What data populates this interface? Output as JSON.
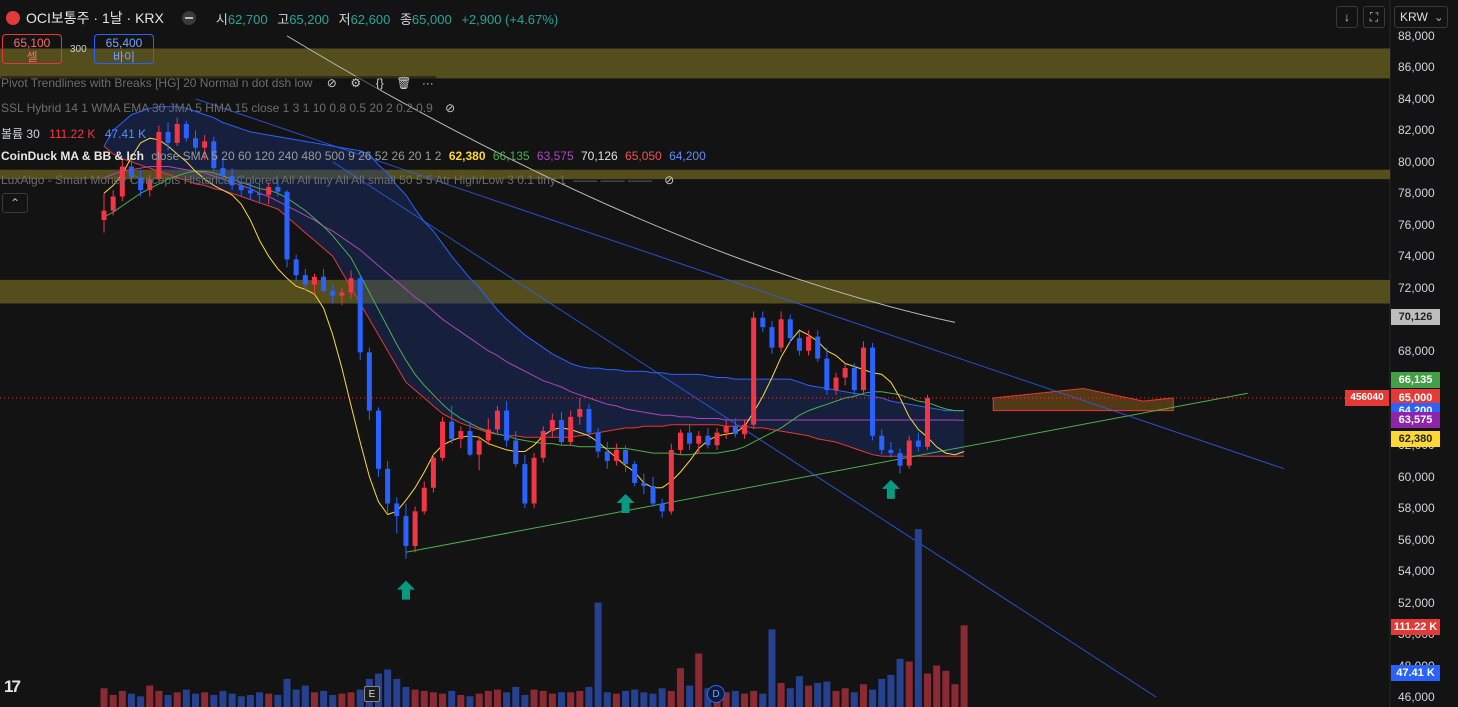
{
  "header": {
    "symbol": "OCI보통주 · 1날 · KRX",
    "open_label": "시",
    "open": "62,700",
    "high_label": "고",
    "high": "65,200",
    "low_label": "저",
    "low": "62,600",
    "close_label": "종",
    "close": "65,000",
    "change": "+2,900 (+4.67%)"
  },
  "trade": {
    "sell_price": "65,100",
    "sell_label": "셀",
    "spread": "300",
    "buy_price": "65,400",
    "buy_label": "바이"
  },
  "indicators": {
    "pivot": "Pivot Trendlines with Breaks [HG] 20 Normal n dot dsh low",
    "ssl": "SSL Hybrid 14 1 WMA EMA 30 JMA 5 HMA 15 close 1 3 1 10 0.8 0.5 20 2 0.2 0.9",
    "volume_name": "볼륨 30",
    "volume_v1": "111.22 K",
    "volume_v2": "47.41 K",
    "coinduck_name": "CoinDuck MA & BB & Ich",
    "coinduck_params": "close SMA 5 20 60 120 240 480 500 9 26 52 26 20 1 2",
    "coinduck_values": [
      "62,380",
      "66,135",
      "63,575",
      "70,126",
      "65,050",
      "64,200"
    ],
    "luxalgo": "LuxAlgo - Smart Money Concepts Historical Colored All All tiny All All small 50 5 5 Atr High/Low 3 0.1 tiny 1"
  },
  "toolbar": {
    "currency": "KRW"
  },
  "axis": {
    "y_ticks": [
      "88,000",
      "86,000",
      "84,000",
      "82,000",
      "80,000",
      "78,000",
      "76,000",
      "74,000",
      "72,000",
      "70,000",
      "68,000",
      "66,000",
      "64,000",
      "62,000",
      "60,000",
      "58,000",
      "56,000",
      "54,000",
      "52,000",
      "50,000",
      "48,000",
      "46,000"
    ]
  },
  "price_tags": [
    {
      "label": "70,126",
      "value": 70126,
      "color": "#bdbdbd",
      "text": "#222222"
    },
    {
      "label": "66,135",
      "value": 66135,
      "color": "#43a047",
      "text": "#ffffff"
    },
    {
      "label": "65,050",
      "value": 65050,
      "color": "#e53935",
      "text": "#ffffff"
    },
    {
      "label": "65,000",
      "value": 65000,
      "color": "#e53935",
      "text": "#ffffff"
    },
    {
      "label": "64,200",
      "value": 64200,
      "color": "#2962ff",
      "text": "#ffffff"
    },
    {
      "label": "63,575",
      "value": 63575,
      "color": "#8e24aa",
      "text": "#ffffff"
    },
    {
      "label": "62,380",
      "value": 62380,
      "color": "#fdd835",
      "text": "#222222"
    }
  ],
  "vol_tags": [
    {
      "label": "111.22 K",
      "color": "#e53935"
    },
    {
      "label": "47.41 K",
      "color": "#2962ff"
    }
  ],
  "last_volume_tag": "456040",
  "markers": {
    "earnings": "E",
    "dividend": "D"
  },
  "colors": {
    "up": "#f23645",
    "down": "#2962ff",
    "zone": "#6b6220"
  },
  "chart_data": {
    "type": "candlestick",
    "ylim": [
      45500,
      88500
    ],
    "zones": [
      [
        85300,
        87200
      ],
      [
        78900,
        79500
      ],
      [
        71000,
        72500
      ]
    ],
    "candles": [
      [
        76300,
        78000,
        75500,
        76900
      ],
      [
        76900,
        78200,
        76600,
        77800
      ],
      [
        77800,
        80200,
        77500,
        79700
      ],
      [
        79700,
        80300,
        78700,
        79000
      ],
      [
        79000,
        79500,
        77800,
        78200
      ],
      [
        78200,
        79200,
        77800,
        78900
      ],
      [
        78900,
        82300,
        78700,
        81900
      ],
      [
        81900,
        82500,
        80700,
        81200
      ],
      [
        81200,
        82800,
        81000,
        82400
      ],
      [
        82400,
        82600,
        81300,
        81500
      ],
      [
        81500,
        82000,
        80500,
        80900
      ],
      [
        80900,
        81700,
        80100,
        81300
      ],
      [
        81300,
        81600,
        79400,
        79600
      ],
      [
        79600,
        80200,
        78800,
        79100
      ],
      [
        79100,
        79600,
        78200,
        78500
      ],
      [
        78500,
        79000,
        77800,
        78200
      ],
      [
        78200,
        78700,
        77600,
        78000
      ],
      [
        78000,
        78600,
        77400,
        77900
      ],
      [
        77900,
        78700,
        77300,
        78400
      ],
      [
        78400,
        78900,
        77800,
        78100
      ],
      [
        78100,
        78200,
        73300,
        73800
      ],
      [
        73800,
        74100,
        72400,
        72800
      ],
      [
        72800,
        73200,
        71800,
        72200
      ],
      [
        72200,
        72900,
        71600,
        72700
      ],
      [
        72700,
        73200,
        71700,
        71800
      ],
      [
        71800,
        72200,
        71000,
        71500
      ],
      [
        71500,
        72000,
        70900,
        71700
      ],
      [
        71700,
        73100,
        71300,
        72600
      ],
      [
        72600,
        72800,
        67400,
        67900
      ],
      [
        67900,
        68200,
        63600,
        64200
      ],
      [
        64200,
        64400,
        60000,
        60500
      ],
      [
        60500,
        61000,
        57700,
        58300
      ],
      [
        58300,
        58700,
        56400,
        57500
      ],
      [
        57500,
        58300,
        54800,
        55600
      ],
      [
        55600,
        58100,
        55200,
        57800
      ],
      [
        57800,
        59700,
        57600,
        59300
      ],
      [
        59300,
        61500,
        59000,
        61200
      ],
      [
        61200,
        63800,
        61000,
        63500
      ],
      [
        63500,
        64500,
        62100,
        62400
      ],
      [
        62400,
        63200,
        61800,
        62900
      ],
      [
        62900,
        63500,
        61300,
        61400
      ],
      [
        61400,
        62600,
        60400,
        62300
      ],
      [
        62300,
        63700,
        62000,
        63000
      ],
      [
        63000,
        64500,
        62700,
        64200
      ],
      [
        64200,
        64800,
        61900,
        62300
      ],
      [
        62300,
        62900,
        60600,
        60800
      ],
      [
        60800,
        61400,
        58000,
        58300
      ],
      [
        58300,
        61500,
        58000,
        61200
      ],
      [
        61200,
        63200,
        60900,
        62900
      ],
      [
        62900,
        64000,
        62500,
        63600
      ],
      [
        63600,
        64100,
        62000,
        62200
      ],
      [
        62200,
        64200,
        62000,
        63800
      ],
      [
        63800,
        65000,
        63300,
        64300
      ],
      [
        64300,
        64600,
        62400,
        62800
      ],
      [
        62800,
        63100,
        61200,
        61600
      ],
      [
        61600,
        62200,
        60500,
        61000
      ],
      [
        61000,
        62100,
        60700,
        61700
      ],
      [
        61700,
        62000,
        60300,
        60800
      ],
      [
        60800,
        61000,
        59400,
        59600
      ],
      [
        59600,
        60200,
        58900,
        59400
      ],
      [
        59400,
        60000,
        58100,
        58300
      ],
      [
        58300,
        58600,
        57400,
        57800
      ],
      [
        57800,
        62100,
        57600,
        61700
      ],
      [
        61700,
        63000,
        61400,
        62800
      ],
      [
        62800,
        63300,
        61700,
        62100
      ],
      [
        62100,
        62900,
        61500,
        62600
      ],
      [
        62600,
        63100,
        61800,
        62000
      ],
      [
        62000,
        63100,
        61700,
        62800
      ],
      [
        62800,
        63600,
        62400,
        63200
      ],
      [
        63200,
        63700,
        62500,
        62700
      ],
      [
        62700,
        63600,
        62400,
        63300
      ],
      [
        63300,
        70500,
        63000,
        70100
      ],
      [
        70100,
        70500,
        69200,
        69500
      ],
      [
        69500,
        69900,
        67800,
        68200
      ],
      [
        68200,
        70500,
        67900,
        70000
      ],
      [
        70000,
        70300,
        68500,
        68800
      ],
      [
        68800,
        69200,
        67700,
        68000
      ],
      [
        68000,
        69300,
        67700,
        68900
      ],
      [
        68900,
        69300,
        67300,
        67500
      ],
      [
        67500,
        68200,
        65200,
        65500
      ],
      [
        65500,
        66600,
        65200,
        66300
      ],
      [
        66300,
        67200,
        65800,
        66900
      ],
      [
        66900,
        67200,
        65200,
        65500
      ],
      [
        65500,
        68600,
        65200,
        68200
      ],
      [
        68200,
        68500,
        62300,
        62600
      ],
      [
        62600,
        63000,
        61400,
        61700
      ],
      [
        61700,
        62200,
        61200,
        61500
      ],
      [
        61500,
        61800,
        60200,
        60700
      ],
      [
        60700,
        62600,
        60500,
        62300
      ],
      [
        62300,
        62800,
        61600,
        61900
      ],
      [
        61900,
        65200,
        61700,
        65000
      ]
    ],
    "volume": [
      14,
      9,
      12,
      10,
      8,
      16,
      12,
      9,
      11,
      13,
      10,
      11,
      9,
      12,
      10,
      8,
      9,
      11,
      10,
      9,
      21,
      13,
      16,
      11,
      12,
      9,
      10,
      11,
      13,
      21,
      25,
      28,
      21,
      15,
      13,
      12,
      11,
      10,
      12,
      9,
      8,
      10,
      12,
      13,
      11,
      15,
      9,
      13,
      12,
      10,
      11,
      11,
      12,
      15,
      78,
      11,
      10,
      12,
      13,
      11,
      10,
      14,
      12,
      29,
      16,
      40,
      14,
      13,
      11,
      12,
      10,
      12,
      10,
      58,
      18,
      14,
      23,
      16,
      18,
      19,
      12,
      14,
      11,
      17,
      13,
      21,
      24,
      36,
      34,
      133,
      25,
      31,
      27,
      17,
      61
    ],
    "vol_series_colors_note": "up=red down=blue",
    "vol_scale_max": 133,
    "ma5": [
      78000,
      78500,
      79200,
      80300,
      81200,
      81500,
      81400,
      81000,
      80500,
      80000,
      79400,
      78900,
      78500,
      78200,
      77900,
      77300,
      76300,
      75000,
      74000,
      73200,
      72600,
      72100,
      71900,
      71600,
      70700,
      69000,
      66900,
      64500,
      62200,
      60000,
      58400,
      57600,
      57800,
      58500,
      59300,
      60300,
      61400,
      62000,
      62300,
      62500,
      62600,
      62500,
      62100,
      61900,
      61700,
      61600,
      61600,
      62000,
      62600,
      63000,
      63100,
      63000,
      62800,
      62600,
      62200,
      61700,
      61200,
      60700,
      60300,
      59600,
      59300,
      59300,
      59700,
      60300,
      61000,
      61800,
      62300,
      62600,
      62700,
      62800,
      63200,
      64100,
      65100,
      66300,
      67600,
      68600,
      69300,
      69000,
      68600,
      68000,
      67700,
      67200,
      67000,
      66800,
      66600,
      66500,
      66000,
      65000,
      63800,
      63000,
      62500,
      61900,
      61500,
      61400,
      61600
    ],
    "ma20": [
      76500,
      76800,
      77200,
      77600,
      78000,
      78300,
      78600,
      78900,
      79100,
      79300,
      79400,
      79400,
      79300,
      79100,
      78900,
      78700,
      78500,
      78300,
      78200,
      78000,
      77700,
      77300,
      76900,
      76400,
      75900,
      75300,
      74600,
      73900,
      72800,
      71700,
      70600,
      69500,
      68400,
      67400,
      66500,
      65800,
      65200,
      64600,
      64100,
      63700,
      63400,
      63100,
      62900,
      62700,
      62600,
      62400,
      62300,
      62200,
      62100,
      62100,
      62000,
      62000,
      61900,
      61900,
      61900,
      61800,
      61800,
      61800,
      61700,
      61600,
      61500,
      61500,
      61500,
      61400,
      61400,
      61500,
      61500,
      61500,
      61600,
      61700,
      61900,
      62200,
      62500,
      62800,
      63100,
      63500,
      63900,
      64200,
      64400,
      64600,
      64800,
      65000,
      65100,
      65300,
      65400,
      65400,
      65300,
      65200,
      65000,
      64800,
      64700,
      64500,
      64300,
      64200,
      64200
    ],
    "ma60": [
      79000,
      79200,
      79400,
      79500,
      79600,
      79700,
      79700,
      79700,
      79600,
      79500,
      79400,
      79300,
      79100,
      78900,
      78700,
      78500,
      78300,
      78000,
      77800,
      77500,
      77200,
      76900,
      76600,
      76300,
      75900,
      75600,
      75200,
      74800,
      74400,
      73900,
      73400,
      72900,
      72400,
      71900,
      71400,
      71000,
      70500,
      70000,
      69600,
      69200,
      68800,
      68400,
      68000,
      67700,
      67300,
      67000,
      66700,
      66400,
      66100,
      65900,
      65700,
      65400,
      65200,
      65000,
      64800,
      64600,
      64500,
      64300,
      64200,
      64100,
      64000,
      63900,
      63900,
      63800,
      63800,
      63700,
      63700,
      63700,
      63600,
      63600,
      63600,
      63600,
      63600,
      63600,
      63600,
      63600,
      63600,
      63600,
      63600,
      63600,
      63600,
      63600,
      63600,
      63600,
      63600,
      63600,
      63600,
      63600,
      63600,
      63600,
      63600,
      63600,
      63600,
      63600,
      63575
    ],
    "cloud_top": [
      81000,
      82000,
      82500,
      83000,
      83200,
      83400,
      83500,
      83500,
      83500,
      83400,
      83200,
      83000,
      82800,
      82500,
      82300,
      82100,
      81900,
      81800,
      81700,
      81600,
      81500,
      81400,
      81300,
      81200,
      81100,
      81000,
      80900,
      80800,
      80700,
      80500,
      79800,
      79300,
      78500,
      77900,
      77000,
      76200,
      75600,
      74800,
      74000,
      73300,
      72600,
      72000,
      71300,
      70600,
      70000,
      69500,
      69000,
      68600,
      68200,
      67800,
      67500,
      67200,
      67000,
      66900,
      66900,
      66800,
      66800,
      66700,
      66700,
      66700,
      66600,
      66600,
      66500,
      66500,
      66500,
      66500,
      66400,
      66300,
      66300,
      66200,
      66200,
      66200,
      66200,
      66200,
      66200,
      66200,
      66000,
      65800,
      65700,
      65600,
      65500,
      65400,
      65300,
      65200,
      65100,
      65000,
      64800,
      64700,
      64600,
      64500,
      64400,
      64300,
      64200,
      64200,
      64200
    ],
    "cloud_bottom": [
      81000,
      80500,
      80200,
      80000,
      79800,
      79600,
      79400,
      79200,
      79000,
      78800,
      78600,
      78500,
      78300,
      78200,
      78000,
      77800,
      77600,
      77400,
      77200,
      77000,
      76500,
      76000,
      75500,
      75000,
      74500,
      74000,
      73000,
      72000,
      71000,
      70000,
      69000,
      68000,
      67000,
      66000,
      65500,
      65000,
      64500,
      64000,
      63700,
      63400,
      63200,
      63000,
      62800,
      62700,
      62600,
      62600,
      62500,
      62500,
      62500,
      62500,
      62500,
      62500,
      62600,
      62700,
      62800,
      62900,
      63000,
      63100,
      63100,
      63200,
      63200,
      63200,
      63300,
      63300,
      63300,
      63300,
      63300,
      63300,
      63200,
      63200,
      63200,
      63100,
      63100,
      63000,
      62900,
      62800,
      62700,
      62600,
      62400,
      62300,
      62200,
      62000,
      61800,
      61600,
      61400,
      61300,
      61300,
      61300,
      61300,
      61300,
      61300,
      61300,
      61300,
      61300,
      61300
    ],
    "trendline_low": {
      "from": [
        33,
        55200
      ],
      "to": [
        125,
        65300
      ]
    },
    "downtrend": [
      {
        "from": [
          10,
          84000
        ],
        "to": [
          129,
          60500
        ]
      },
      {
        "from": [
          25,
          80000
        ],
        "to": [
          115,
          46000
        ]
      }
    ],
    "ma120": {
      "from": [
        20,
        88000
      ],
      "to": [
        93,
        69800
      ]
    },
    "arrows_idx": [
      33,
      57,
      86
    ]
  }
}
